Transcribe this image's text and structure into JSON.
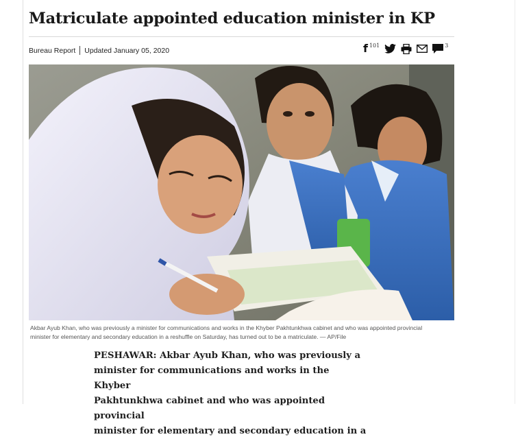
{
  "article": {
    "headline": "Matriculate appointed education minister in KP",
    "author": "Bureau Report",
    "updated": "Updated January 05, 2020",
    "photo_caption": "Akbar Ayub Khan, who was previously a minister for communications and works in the Khyber Pakhtunkhwa cabinet and who was appointed provincial minister for elementary and secondary education in a reshuffle on Saturday, has turned out to be a matriculate. — AP/File",
    "lines": [
      "PESHAWAR: Akbar Ayub Khan, who was previously a",
      "minister for communications and works in the Khyber",
      "Pakhtunkhwa cabinet and who was appointed provincial",
      "minister for elementary and secondary education in a"
    ]
  },
  "share": {
    "facebook_glyph": "f",
    "facebook_count": "101",
    "comment_count": "3",
    "icons": [
      "facebook-icon",
      "twitter-icon",
      "print-icon",
      "email-icon",
      "comment-icon"
    ]
  },
  "colors": {
    "text": "#1a1a1a",
    "rule": "#d8d8d8",
    "caption": "#555555"
  }
}
